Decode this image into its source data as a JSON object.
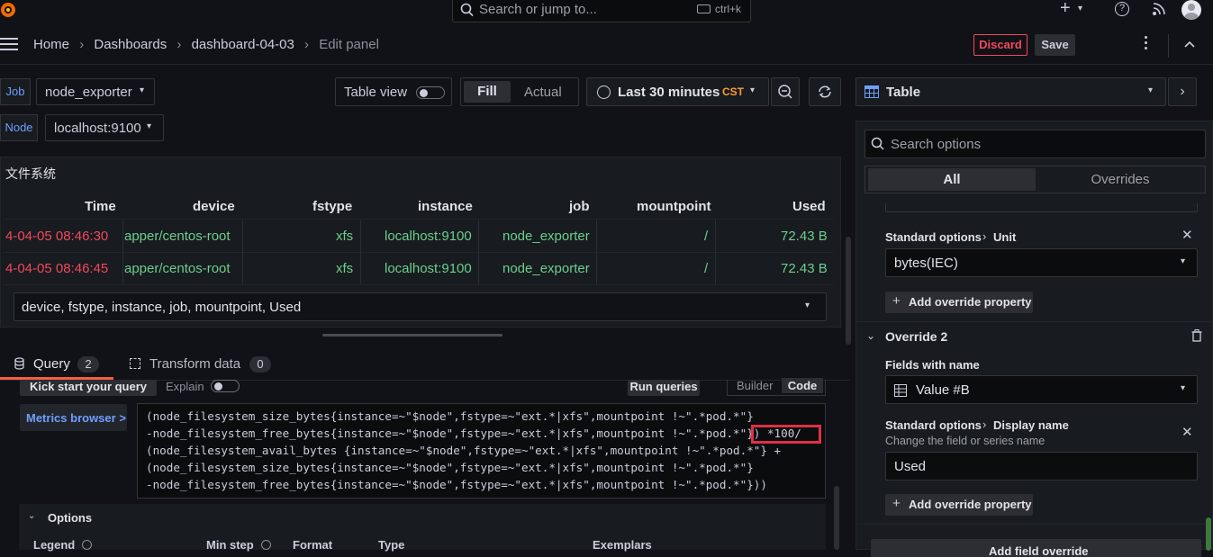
{
  "topbar": {
    "search_placeholder": "Search or jump to...",
    "search_shortcut": "ctrl+k",
    "plus_label": "+",
    "icons": [
      "grafana-logo-icon",
      "plus-icon",
      "help-icon",
      "rss-icon",
      "avatar"
    ]
  },
  "breadcrumb": {
    "home": "Home",
    "dashboards": "Dashboards",
    "dashboard": "dashboard-04-03",
    "current": "Edit panel"
  },
  "nav_actions": {
    "discard": "Discard",
    "save": "Save"
  },
  "variables": {
    "job_label": "Job",
    "job_value": "node_exporter",
    "node_label": "Node",
    "node_value": "localhost:9100"
  },
  "toolbar": {
    "table_view": "Table view",
    "fill": "Fill",
    "actual": "Actual",
    "time_range": "Last 30 minutes",
    "timezone": "CST"
  },
  "panel": {
    "title": "文件系统",
    "columns": [
      "Time",
      "device",
      "fstype",
      "instance",
      "job",
      "mountpoint",
      "Used"
    ],
    "rows": [
      [
        "4-04-05 08:46:30",
        "apper/centos-root",
        "xfs",
        "localhost:9100",
        "node_exporter",
        "/",
        "72.43 B"
      ],
      [
        "4-04-05 08:46:45",
        "apper/centos-root",
        "xfs",
        "localhost:9100",
        "node_exporter",
        "/",
        "72.43 B"
      ]
    ],
    "frame_select": "device, fstype, instance, job, mountpoint, Used"
  },
  "query_tabs": {
    "query_label": "Query",
    "query_count": "2",
    "transform_label": "Transform data",
    "transform_count": "0"
  },
  "query_editor": {
    "kick_start": "Kick start your query",
    "explain": "Explain",
    "run_queries": "Run queries",
    "builder": "Builder",
    "code": "Code",
    "metrics_browser": "Metrics browser >",
    "query_lines": [
      "(node_filesystem_size_bytes{instance=~\"$node\",fstype=~\"ext.*|xfs\",mountpoint !~\".*pod.*\"}",
      "-node_filesystem_free_bytes{instance=~\"$node\",fstype=~\"ext.*|xfs\",mountpoint !~\".*pod.*\"}) *100/",
      "(node_filesystem_avail_bytes {instance=~\"$node\",fstype=~\"ext.*|xfs\",mountpoint !~\".*pod.*\"} +",
      "(node_filesystem_size_bytes{instance=~\"$node\",fstype=~\"ext.*|xfs\",mountpoint !~\".*pod.*\"}",
      "-node_filesystem_free_bytes{instance=~\"$node\",fstype=~\"ext.*|xfs\",mountpoint !~\".*pod.*\"}))"
    ],
    "options_label": "Options",
    "options_cols": [
      "Legend",
      "Min step",
      "Format",
      "Type",
      "Exemplars"
    ]
  },
  "right_panel": {
    "viz": "Table",
    "search_placeholder": "Search options",
    "tab_all": "All",
    "tab_overrides": "Overrides",
    "override1": {
      "prop_path": "Standard options",
      "prop_name": "Unit",
      "value": "bytes(IEC)",
      "add_property": "Add override property"
    },
    "override2": {
      "title": "Override 2",
      "matcher_label": "Fields with name",
      "matcher_value": "Value #B",
      "prop_path": "Standard options",
      "prop_name": "Display name",
      "prop_desc": "Change the field or series name",
      "value": "Used",
      "add_property": "Add override property"
    },
    "add_field_override": "Add field override"
  },
  "colors": {
    "accent": "#f55f3e",
    "link": "#6e9fff",
    "green_text": "#6ccf8e",
    "red_time": "#f2495c",
    "discard": "#f2495c",
    "highlight_box": "#e02f44"
  }
}
